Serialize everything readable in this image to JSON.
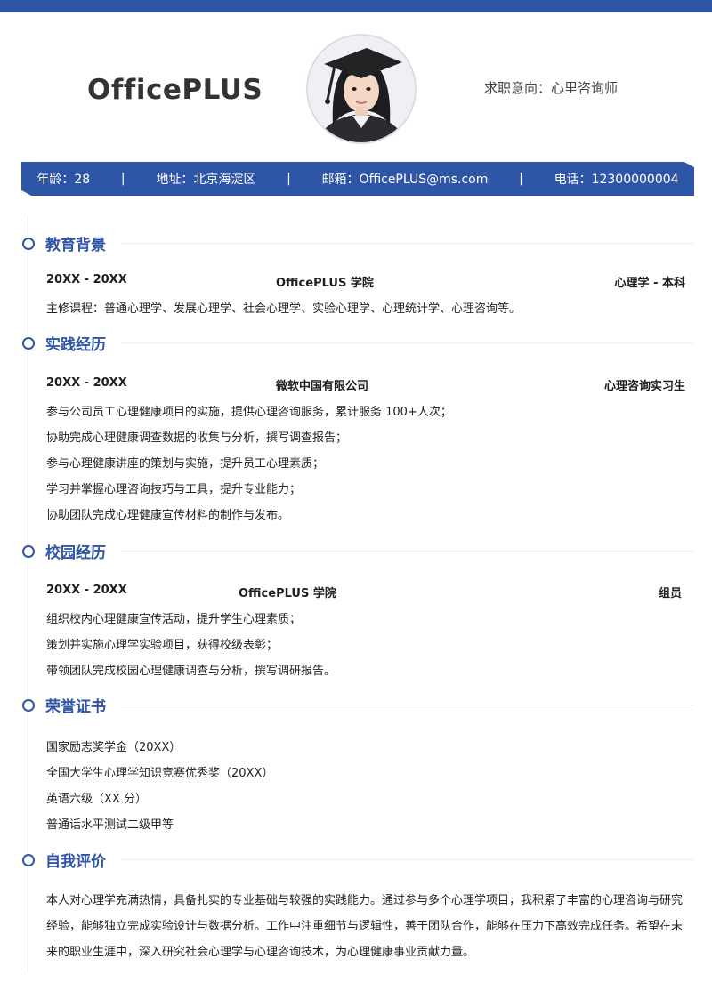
{
  "header": {
    "brand": "OfficePLUS",
    "objective": "求职意向：心里咨询师"
  },
  "info": {
    "age": "年龄：28",
    "address": "地址：北京海淀区",
    "email": "邮箱：OfficePLUS@ms.com",
    "phone": "电话：12300000004",
    "separator": "|"
  },
  "education": {
    "title": "教育背景",
    "date": "20XX - 20XX",
    "school": "OfficePLUS 学院",
    "degree": "心理学 - 本科",
    "courses": "主修课程：普通心理学、发展心理学、社会心理学、实验心理学、心理统计学、心理咨询等。"
  },
  "practice": {
    "title": "实践经历",
    "date": "20XX - 20XX",
    "company": "微软中国有限公司",
    "role": "心理咨询实习生",
    "items": [
      "参与公司员工心理健康项目的实施，提供心理咨询服务，累计服务 100+人次；",
      "协助完成心理健康调查数据的收集与分析，撰写调查报告；",
      "参与心理健康讲座的策划与实施，提升员工心理素质；",
      "学习并掌握心理咨询技巧与工具，提升专业能力；",
      "协助团队完成心理健康宣传材料的制作与发布。"
    ]
  },
  "campus": {
    "title": "校园经历",
    "date": "20XX - 20XX",
    "org": "OfficePLUS 学院",
    "role": "组员",
    "items": [
      "组织校内心理健康宣传活动，提升学生心理素质；",
      "策划并实施心理学实验项目，获得校级表彰；",
      "带领团队完成校园心理健康调查与分析，撰写调研报告。"
    ]
  },
  "honors": {
    "title": "荣誉证书",
    "items": [
      "国家励志奖学金（20XX）",
      "全国大学生心理学知识竞赛优秀奖（20XX）",
      "英语六级（XX 分）",
      "普通话水平测试二级甲等"
    ]
  },
  "self": {
    "title": "自我评价",
    "text": "本人对心理学充满热情，具备扎实的专业基础与较强的实践能力。通过参与多个心理学项目，我积累了丰富的心理咨询与研究经验，能够独立完成实验设计与数据分析。工作中注重细节与逻辑性，善于团队合作，能够在压力下高效完成任务。希望在未来的职业生涯中，深入研究社会心理学与心理咨询技术，为心理健康事业贡献力量。"
  },
  "colors": {
    "accent": "#2f55a7"
  }
}
